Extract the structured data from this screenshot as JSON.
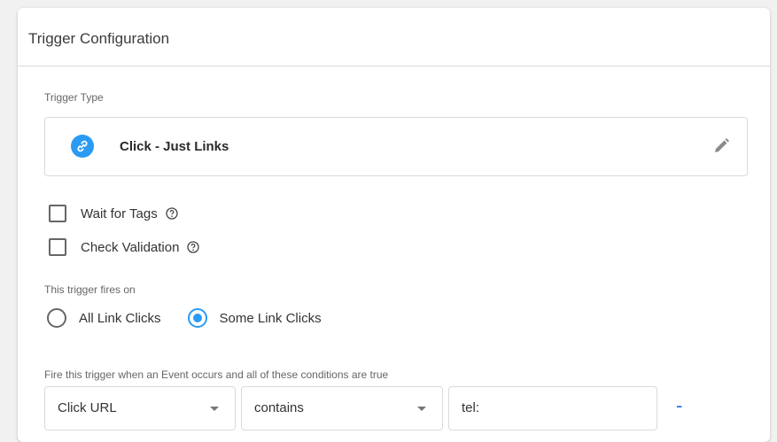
{
  "card": {
    "title": "Trigger Configuration"
  },
  "trigger_type": {
    "label": "Trigger Type",
    "name": "Click - Just Links",
    "icon": "link-icon",
    "icon_color": "#2b9af3"
  },
  "options": [
    {
      "label": "Wait for Tags",
      "checked": false
    },
    {
      "label": "Check Validation",
      "checked": false
    }
  ],
  "fires_on": {
    "label": "This trigger fires on",
    "choices": [
      {
        "label": "All Link Clicks",
        "selected": false
      },
      {
        "label": "Some Link Clicks",
        "selected": true
      }
    ]
  },
  "condition": {
    "label": "Fire this trigger when an Event occurs and all of these conditions are true",
    "variable": "Click URL",
    "operator": "contains",
    "value": "tel:",
    "remove_label": "-"
  }
}
